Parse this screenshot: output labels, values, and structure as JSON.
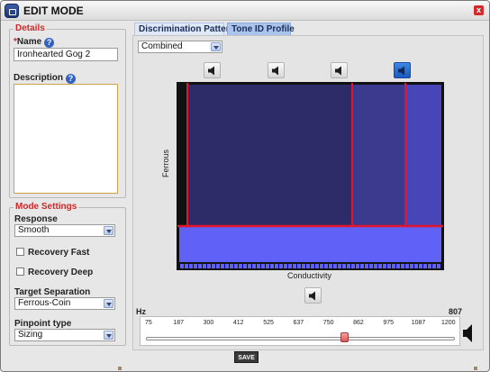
{
  "window": {
    "title": "EDIT MODE",
    "close_label": "x"
  },
  "details": {
    "legend": "Details",
    "name_label": "Name",
    "name_value": "Ironhearted Gog 2",
    "description_label": "Description",
    "description_value": ""
  },
  "mode_settings": {
    "legend": "Mode Settings",
    "response_label": "Response",
    "response_value": "Smooth",
    "recovery_fast_label": "Recovery Fast",
    "recovery_deep_label": "Recovery Deep",
    "target_separation_label": "Target Separation",
    "target_separation_value": "Ferrous-Coin",
    "pinpoint_label": "Pinpoint type",
    "pinpoint_value": "Sizing"
  },
  "tabs": [
    {
      "label": "Discrimination Pattern",
      "active": true
    },
    {
      "label": "Tone ID Profile",
      "active": false
    }
  ],
  "pattern_select": {
    "value": "Combined"
  },
  "tone_buttons": [
    {
      "icon": "speaker-icon",
      "active": false
    },
    {
      "icon": "speaker-icon",
      "active": false
    },
    {
      "icon": "speaker-icon",
      "active": false
    },
    {
      "icon": "speaker-icon",
      "active": true
    }
  ],
  "plot": {
    "xlabel": "Conductivity",
    "ylabel": "Ferrous",
    "colors": {
      "dark": "#2d2b68",
      "mid": "#3c3a8f",
      "light": "#4845b8",
      "bottom": "#6061f6",
      "border": "#e2152f",
      "frame": "#111111"
    }
  },
  "frequency": {
    "unit_label": "Hz",
    "current_value": "807",
    "ticks": [
      "75",
      "187",
      "300",
      "412",
      "525",
      "637",
      "750",
      "862",
      "975",
      "1087",
      "1200"
    ],
    "min": 75,
    "max": 1200,
    "value": 807
  },
  "save_label": "SAVE"
}
